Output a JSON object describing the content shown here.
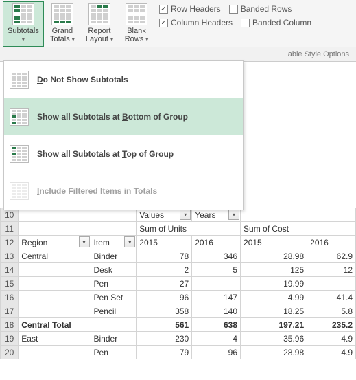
{
  "ribbon": {
    "subtotals": "Subtotals",
    "grand_totals_l1": "Grand",
    "grand_totals_l2": "Totals",
    "report_layout_l1": "Report",
    "report_layout_l2": "Layout",
    "blank_rows_l1": "Blank",
    "blank_rows_l2": "Rows",
    "row_headers": "Row Headers",
    "column_headers": "Column Headers",
    "banded_rows": "Banded Rows",
    "banded_columns": "Banded Column",
    "style_options": "able Style Options"
  },
  "menu": {
    "do_not_show": {
      "pre": "",
      "u": "D",
      "post": "o Not Show Subtotals"
    },
    "bottom": {
      "pre": "Show all Subtotals at ",
      "u": "B",
      "post": "ottom of Group"
    },
    "top": {
      "pre": "Show all Subtotals at ",
      "u": "T",
      "post": "op of Group"
    },
    "include": {
      "pre": "",
      "u": "I",
      "post": "nclude Filtered Items in Totals"
    }
  },
  "pivot": {
    "values_label": "Values",
    "years_label": "Years",
    "sum_units": "Sum of Units",
    "sum_cost": "Sum of Cost",
    "region_label": "Region",
    "item_label": "Item",
    "y2015": "2015",
    "y2016": "2016"
  },
  "chart_data": {
    "type": "table",
    "rows": [
      {
        "n": "10",
        "region": "",
        "item": "",
        "c1": "Values",
        "c2": "",
        "c3": "Years",
        "c4": ""
      },
      {
        "n": "11",
        "region": "",
        "item": "",
        "c1": "Sum of Units",
        "c2": "",
        "c3": "Sum of Cost",
        "c4": ""
      },
      {
        "n": "12",
        "region": "Region",
        "item": "Item",
        "c1": "2015",
        "c2": "2016",
        "c3": "2015",
        "c4": "2016"
      },
      {
        "n": "13",
        "region": "Central",
        "item": "Binder",
        "c1": "78",
        "c2": "346",
        "c3": "28.98",
        "c4": "62.9"
      },
      {
        "n": "14",
        "region": "",
        "item": "Desk",
        "c1": "2",
        "c2": "5",
        "c3": "125",
        "c4": "12"
      },
      {
        "n": "15",
        "region": "",
        "item": "Pen",
        "c1": "27",
        "c2": "",
        "c3": "19.99",
        "c4": ""
      },
      {
        "n": "16",
        "region": "",
        "item": "Pen Set",
        "c1": "96",
        "c2": "147",
        "c3": "4.99",
        "c4": "41.4"
      },
      {
        "n": "17",
        "region": "",
        "item": "Pencil",
        "c1": "358",
        "c2": "140",
        "c3": "18.25",
        "c4": "5.8"
      },
      {
        "n": "18",
        "region": "Central Total",
        "item": "",
        "c1": "561",
        "c2": "638",
        "c3": "197.21",
        "c4": "235.2"
      },
      {
        "n": "19",
        "region": "East",
        "item": "Binder",
        "c1": "230",
        "c2": "4",
        "c3": "35.96",
        "c4": "4.9"
      },
      {
        "n": "20",
        "region": "",
        "item": "Pen",
        "c1": "79",
        "c2": "96",
        "c3": "28.98",
        "c4": "4.9"
      }
    ]
  }
}
